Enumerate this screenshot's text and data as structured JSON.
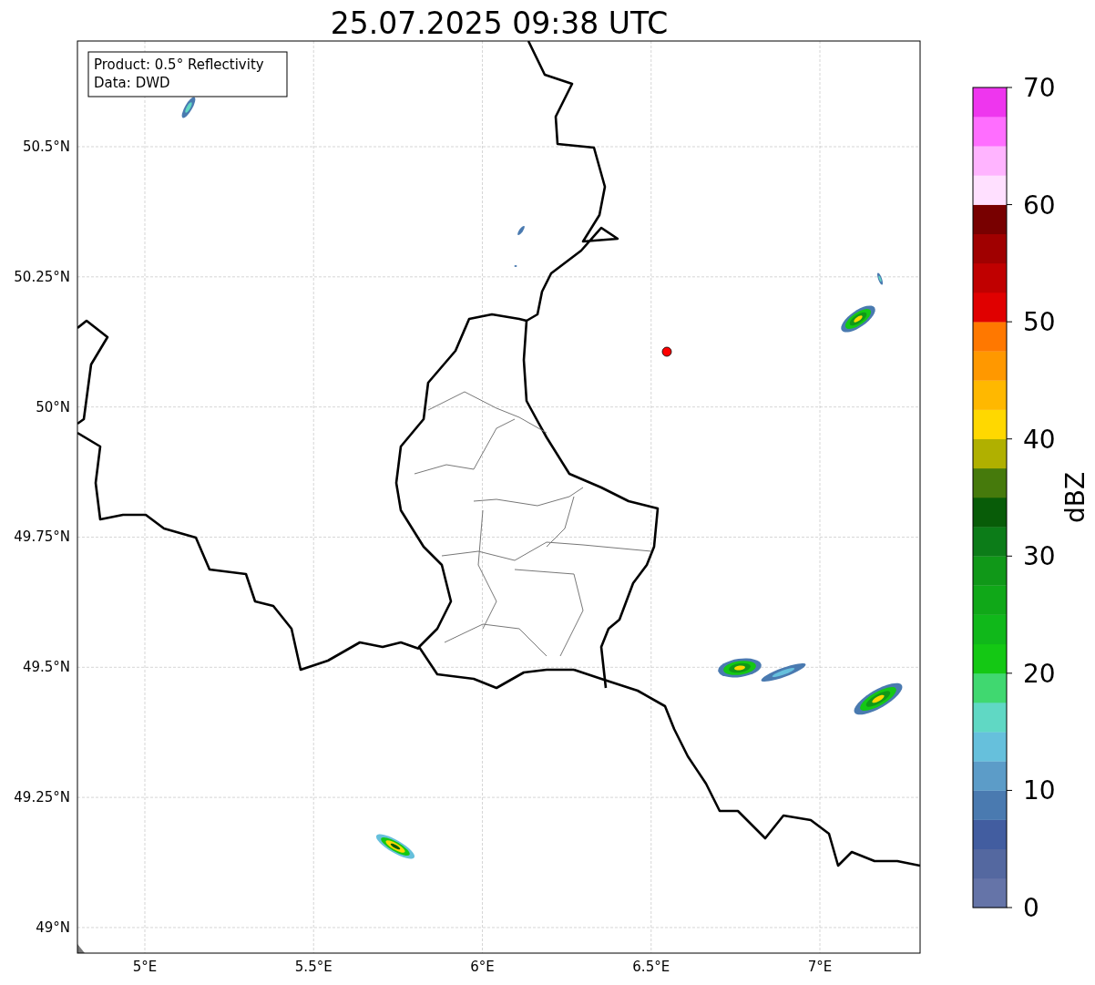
{
  "title": "25.07.2025 09:38 UTC",
  "info_box": [
    "Product: 0.5° Reflectivity",
    "Data: DWD"
  ],
  "x_ticks": [
    "5°E",
    "5.5°E",
    "6°E",
    "6.5°E",
    "7°E"
  ],
  "y_ticks": [
    "50.5°N",
    "50.25°N",
    "50°N",
    "49.75°N",
    "49.5°N",
    "49.25°N",
    "49°N"
  ],
  "colorbar": {
    "label": "dBZ",
    "ticks": [
      "70",
      "60",
      "50",
      "40",
      "30",
      "20",
      "10",
      "0"
    ],
    "bins": [
      {
        "color": "#6574a8"
      },
      {
        "color": "#5468a0"
      },
      {
        "color": "#425da0"
      },
      {
        "color": "#4a7ab0"
      },
      {
        "color": "#5c9cc8"
      },
      {
        "color": "#66c0dc"
      },
      {
        "color": "#60d8c4"
      },
      {
        "color": "#40d870"
      },
      {
        "color": "#14c814"
      },
      {
        "color": "#10b81a"
      },
      {
        "color": "#10a818"
      },
      {
        "color": "#109818"
      },
      {
        "color": "#0c7c18"
      },
      {
        "color": "#085c08"
      },
      {
        "color": "#467a0c"
      },
      {
        "color": "#b0b000"
      },
      {
        "color": "#ffd800"
      },
      {
        "color": "#ffb800"
      },
      {
        "color": "#ff9800"
      },
      {
        "color": "#ff7800"
      },
      {
        "color": "#e00000"
      },
      {
        "color": "#c00000"
      },
      {
        "color": "#a00000"
      },
      {
        "color": "#780000"
      },
      {
        "color": "#ffe0ff"
      },
      {
        "color": "#ffb4ff"
      },
      {
        "color": "#ff6eff"
      },
      {
        "color": "#ee36ee"
      }
    ]
  }
}
